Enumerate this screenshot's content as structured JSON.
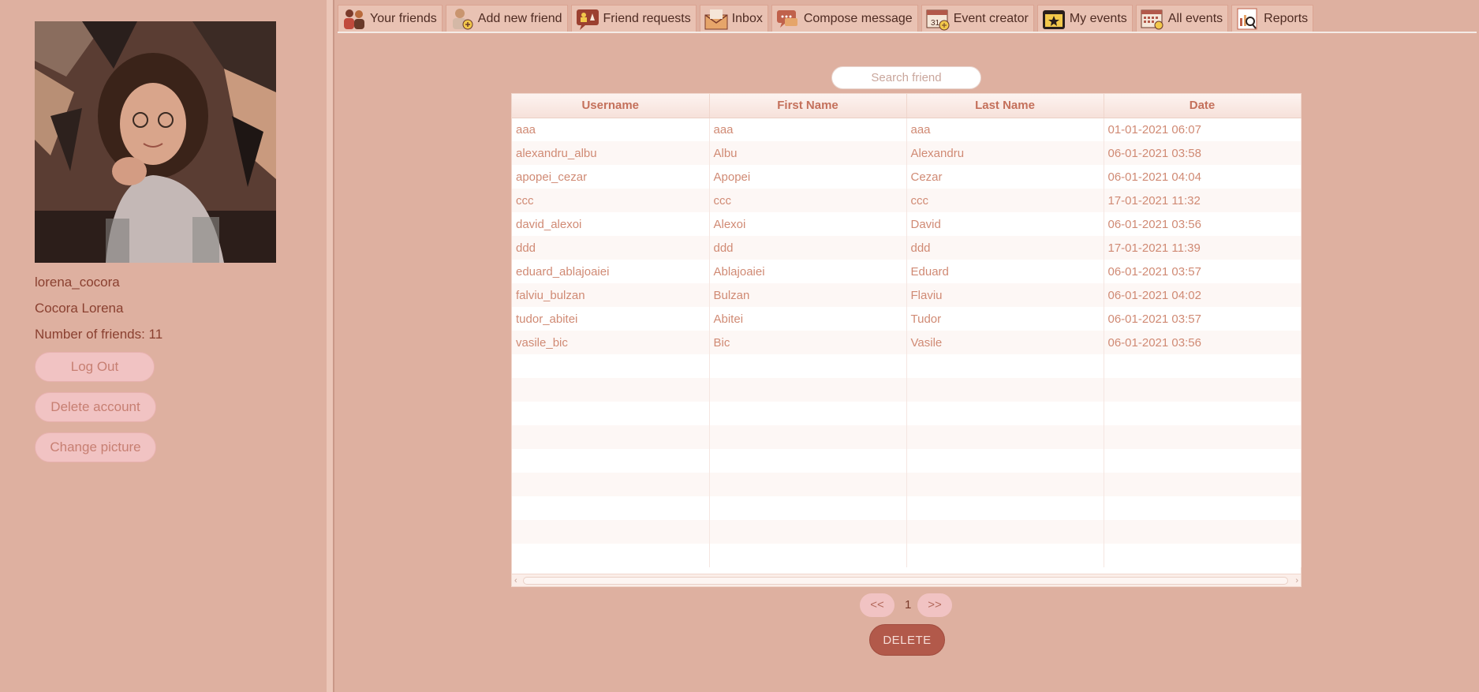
{
  "profile": {
    "username": "lorena_cocora",
    "full_name": "Cocora Lorena",
    "friends_count_text": "Number of friends: 11"
  },
  "sidebar_buttons": {
    "logout": "Log Out",
    "delete_account": "Delete account",
    "change_picture": "Change picture"
  },
  "tabs": [
    {
      "label": "Your friends",
      "icon": "friends-icon"
    },
    {
      "label": "Add new friend",
      "icon": "add-friend-icon"
    },
    {
      "label": "Friend requests",
      "icon": "friend-requests-icon"
    },
    {
      "label": "Inbox",
      "icon": "inbox-icon"
    },
    {
      "label": "Compose message",
      "icon": "compose-icon"
    },
    {
      "label": "Event creator",
      "icon": "event-creator-icon"
    },
    {
      "label": "My events",
      "icon": "my-events-icon"
    },
    {
      "label": "All events",
      "icon": "all-events-icon"
    },
    {
      "label": "Reports",
      "icon": "reports-icon"
    }
  ],
  "search": {
    "placeholder": "Search friend"
  },
  "table": {
    "columns": [
      "Username",
      "First Name",
      "Last Name",
      "Date"
    ],
    "rows": [
      [
        "aaa",
        "aaa",
        "aaa",
        "01-01-2021 06:07"
      ],
      [
        "alexandru_albu",
        "Albu",
        "Alexandru",
        "06-01-2021 03:58"
      ],
      [
        "apopei_cezar",
        "Apopei",
        "Cezar",
        "06-01-2021 04:04"
      ],
      [
        "ccc",
        "ccc",
        "ccc",
        "17-01-2021 11:32"
      ],
      [
        "david_alexoi",
        "Alexoi",
        "David",
        "06-01-2021 03:56"
      ],
      [
        "ddd",
        "ddd",
        "ddd",
        "17-01-2021 11:39"
      ],
      [
        "eduard_ablajoaiei",
        "Ablajoaiei",
        "Eduard",
        "06-01-2021 03:57"
      ],
      [
        "falviu_bulzan",
        "Bulzan",
        "Flaviu",
        "06-01-2021 04:02"
      ],
      [
        "tudor_abitei",
        "Abitei",
        "Tudor",
        "06-01-2021 03:57"
      ],
      [
        "vasile_bic",
        "Bic",
        "Vasile",
        "06-01-2021 03:56"
      ]
    ]
  },
  "pager": {
    "prev": "<<",
    "page": "1",
    "next": ">>"
  },
  "actions": {
    "delete": "DELETE"
  },
  "colors": {
    "background": "#deb0a0",
    "accent": "#b2594a",
    "text": "#d08a74"
  }
}
